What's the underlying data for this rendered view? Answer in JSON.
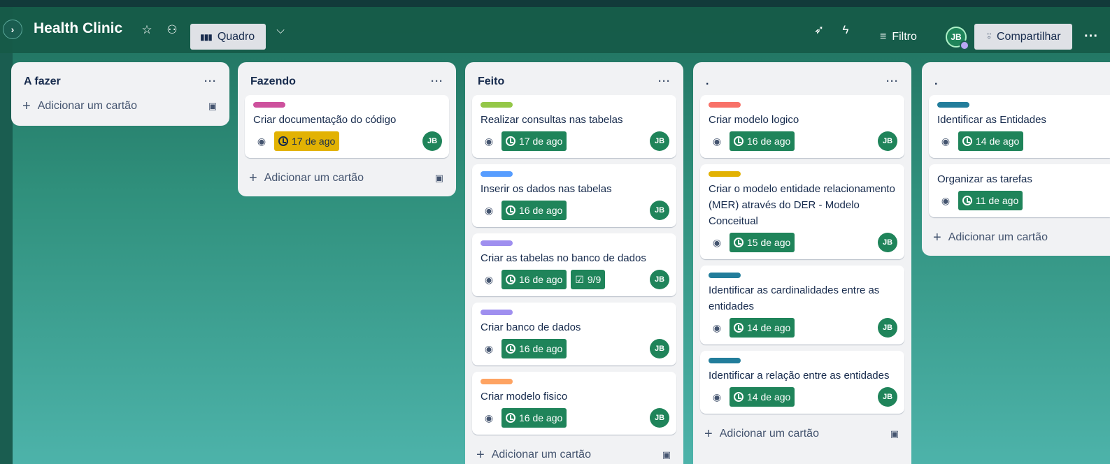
{
  "header": {
    "board_title": "Health Clinic",
    "view_label": "Quadro",
    "filter_label": "Filtro",
    "avatar": "JB",
    "share_label": "Compartilhar"
  },
  "lists": [
    {
      "title": "A fazer",
      "add_label": "Adicionar um cartão",
      "cards": []
    },
    {
      "title": "Fazendo",
      "add_label": "Adicionar um cartão",
      "cards": [
        {
          "label_color": "#cd519d",
          "title": "Criar documentação do código",
          "date": "17 de ago",
          "date_status": "warn",
          "member": "JB"
        }
      ]
    },
    {
      "title": "Feito",
      "add_label": "Adicionar um cartão",
      "cards": [
        {
          "label_color": "#94c748",
          "title": "Realizar consultas nas tabelas",
          "date": "17 de ago",
          "date_status": "done",
          "member": "JB"
        },
        {
          "label_color": "#579dff",
          "title": "Inserir os dados nas tabelas",
          "date": "16 de ago",
          "date_status": "done",
          "member": "JB"
        },
        {
          "label_color": "#9f8fef",
          "title": "Criar as tabelas no banco de dados",
          "date": "16 de ago",
          "date_status": "done",
          "checklist": "9/9",
          "member": "JB"
        },
        {
          "label_color": "#9f8fef",
          "title": "Criar banco de dados",
          "date": "16 de ago",
          "date_status": "done",
          "member": "JB"
        },
        {
          "label_color": "#fea362",
          "title": "Criar modelo fisico",
          "date": "16 de ago",
          "date_status": "done",
          "member": "JB"
        }
      ]
    },
    {
      "title": ".",
      "add_label": "Adicionar um cartão",
      "cards": [
        {
          "label_color": "#f87168",
          "title": "Criar modelo logico",
          "date": "16 de ago",
          "date_status": "done",
          "member": "JB"
        },
        {
          "label_color": "#e2b203",
          "title": "Criar o modelo entidade relacionamento (MER) através do DER - Modelo Conceitual",
          "date": "15 de ago",
          "date_status": "done",
          "member": "JB"
        },
        {
          "label_color": "#227d9b",
          "title": "Identificar as cardinalidades entre as entidades",
          "date": "14 de ago",
          "date_status": "done",
          "member": "JB"
        },
        {
          "label_color": "#227d9b",
          "title": "Identificar a relação entre as entidades",
          "date": "14 de ago",
          "date_status": "done",
          "member": "JB"
        }
      ]
    },
    {
      "title": ".",
      "add_label": "Adicionar um cartão",
      "cards": [
        {
          "label_color": "#227d9b",
          "title": "Identificar as Entidades",
          "date": "14 de ago",
          "date_status": "done",
          "member": ""
        },
        {
          "label_color": "",
          "title": "Organizar as tarefas",
          "date": "11 de ago",
          "date_status": "done",
          "member": ""
        }
      ]
    }
  ],
  "colors": {
    "header_bg": "#165a48",
    "date_done": "#1f845a",
    "date_warn": "#e2b203"
  }
}
